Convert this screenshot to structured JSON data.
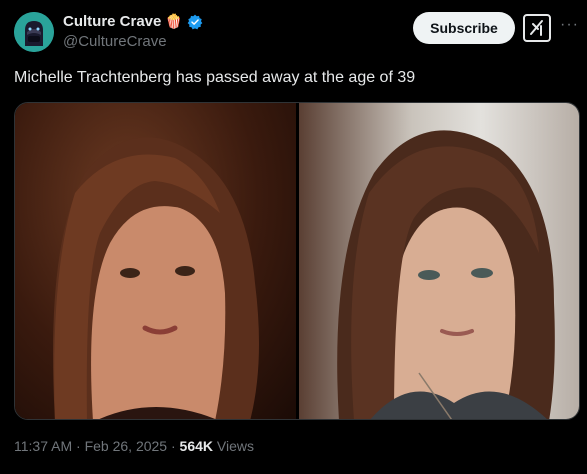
{
  "author": {
    "name": "Culture Crave",
    "emoji": "🍿",
    "handle": "@CultureCrave",
    "verified_color": "#1d9bf0"
  },
  "actions": {
    "subscribe_label": "Subscribe",
    "more_label": "···"
  },
  "tweet": {
    "text": "Michelle Trachtenberg has passed away at the age of 39"
  },
  "meta": {
    "time": "11:37 AM",
    "date": "Feb 26, 2025",
    "views_count": "564K",
    "views_label": "Views",
    "separator": "·"
  },
  "icons": {
    "verified": "verified-badge-icon",
    "grok": "grok-icon",
    "more": "more-options-icon"
  }
}
